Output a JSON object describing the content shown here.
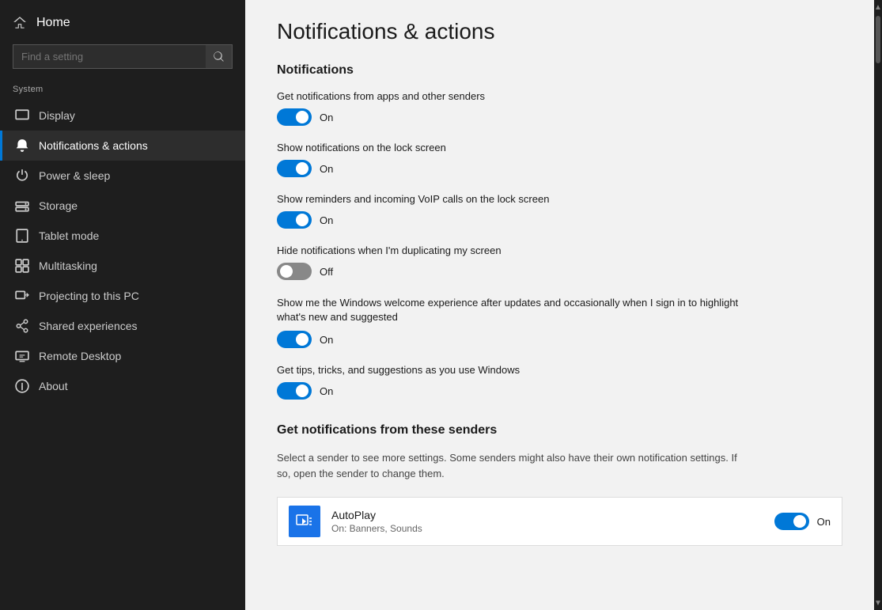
{
  "sidebar": {
    "home": {
      "label": "Home"
    },
    "search_placeholder": "Find a setting",
    "system_label": "System",
    "nav_items": [
      {
        "id": "display",
        "label": "Display",
        "icon": "monitor"
      },
      {
        "id": "notifications",
        "label": "Notifications & actions",
        "icon": "bell",
        "active": true
      },
      {
        "id": "power",
        "label": "Power & sleep",
        "icon": "power"
      },
      {
        "id": "storage",
        "label": "Storage",
        "icon": "storage"
      },
      {
        "id": "tablet",
        "label": "Tablet mode",
        "icon": "tablet"
      },
      {
        "id": "multitasking",
        "label": "Multitasking",
        "icon": "multitask"
      },
      {
        "id": "projecting",
        "label": "Projecting to this PC",
        "icon": "project"
      },
      {
        "id": "shared",
        "label": "Shared experiences",
        "icon": "shared"
      },
      {
        "id": "remote",
        "label": "Remote Desktop",
        "icon": "remote"
      },
      {
        "id": "about",
        "label": "About",
        "icon": "info"
      }
    ]
  },
  "main": {
    "page_title": "Notifications & actions",
    "notifications_section": "Notifications",
    "toggles": [
      {
        "id": "t1",
        "label": "Get notifications from apps and other senders",
        "state": "on",
        "state_label": "On"
      },
      {
        "id": "t2",
        "label": "Show notifications on the lock screen",
        "state": "on",
        "state_label": "On"
      },
      {
        "id": "t3",
        "label": "Show reminders and incoming VoIP calls on the lock screen",
        "state": "on",
        "state_label": "On"
      },
      {
        "id": "t4",
        "label": "Hide notifications when I'm duplicating my screen",
        "state": "off",
        "state_label": "Off"
      },
      {
        "id": "t5",
        "label": "Show me the Windows welcome experience after updates and occasionally when I sign in to highlight what's new and suggested",
        "state": "on",
        "state_label": "On"
      },
      {
        "id": "t6",
        "label": "Get tips, tricks, and suggestions as you use Windows",
        "state": "on",
        "state_label": "On"
      }
    ],
    "senders_section": "Get notifications from these senders",
    "senders_desc": "Select a sender to see more settings. Some senders might also have their own notification settings. If so, open the sender to change them.",
    "apps": [
      {
        "id": "autoplay",
        "name": "AutoPlay",
        "sub": "On: Banners, Sounds",
        "state": "on",
        "state_label": "On"
      }
    ]
  }
}
